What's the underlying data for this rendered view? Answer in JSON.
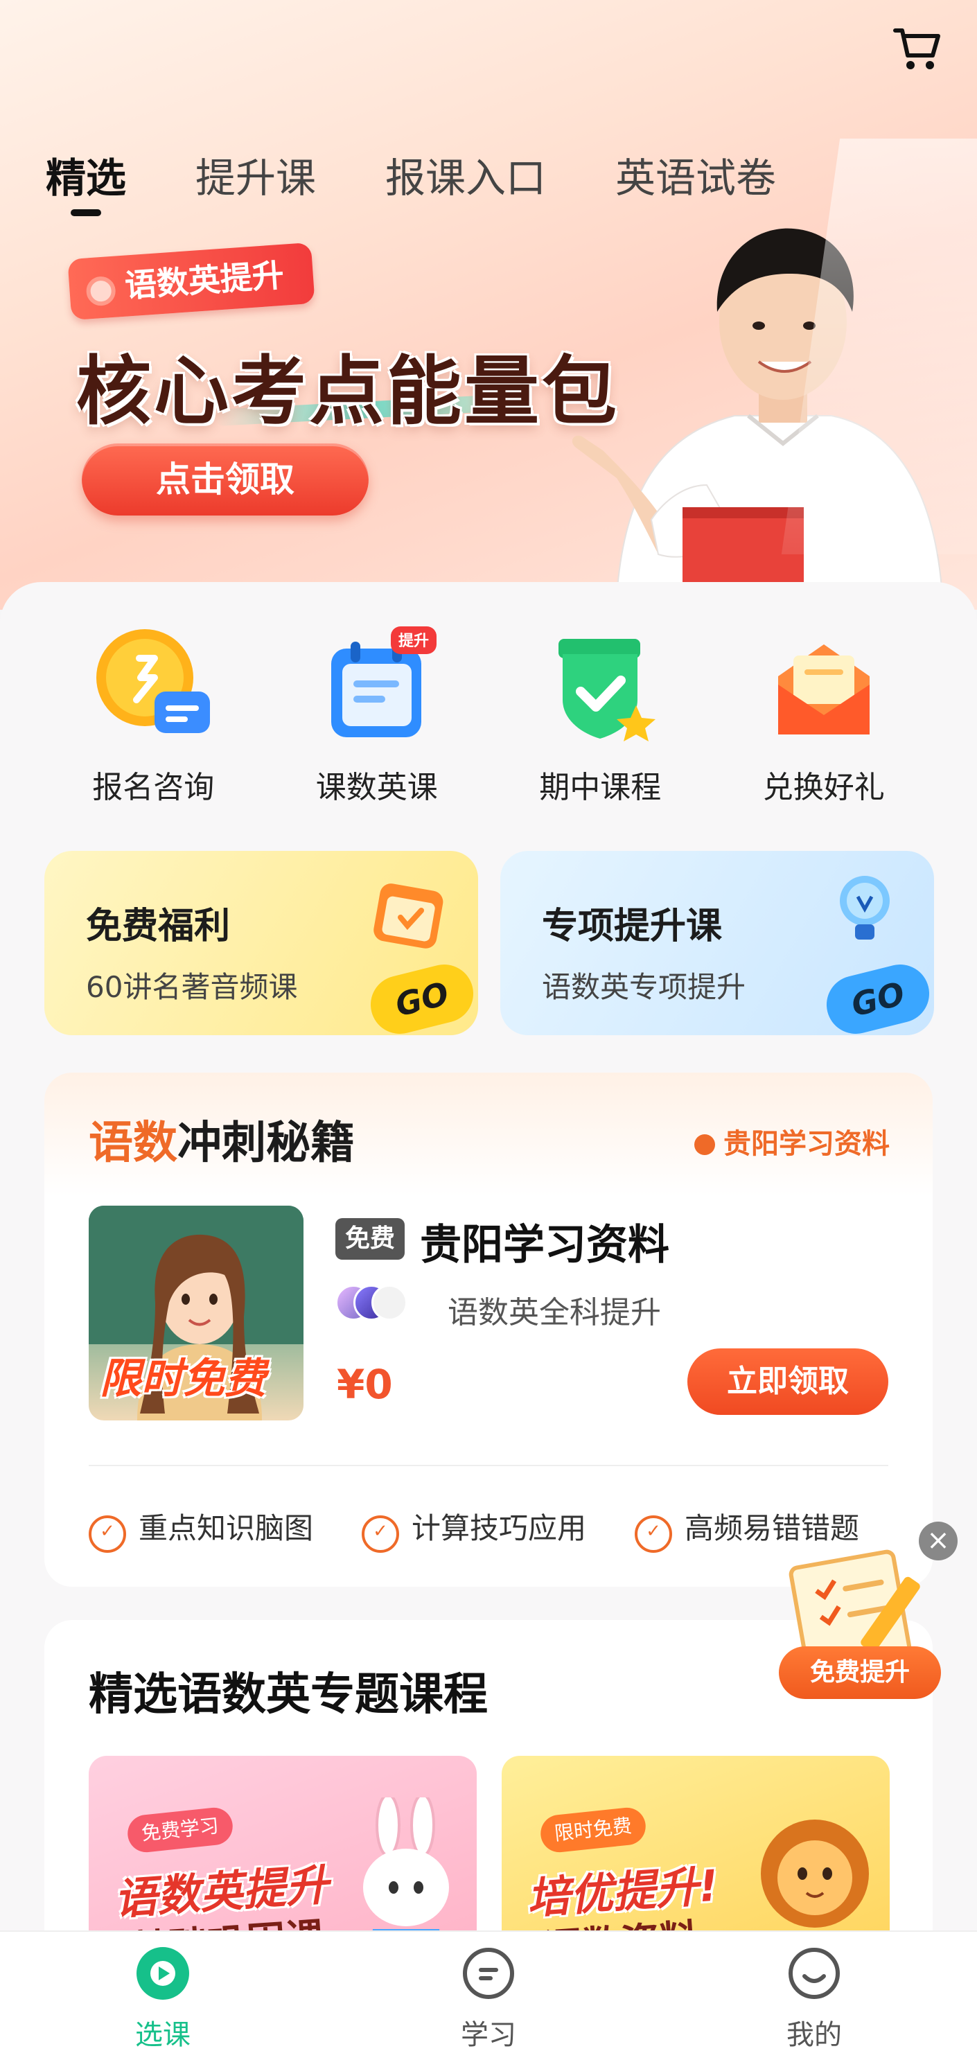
{
  "header": {
    "tabs": [
      {
        "label": "精选",
        "active": true
      },
      {
        "label": "提升课",
        "active": false
      },
      {
        "label": "报课入口",
        "active": false
      },
      {
        "label": "英语试卷",
        "active": false
      }
    ],
    "cart_icon": "cart-icon"
  },
  "banner": {
    "tag": "语数英提升",
    "headline": "核心考点能量包",
    "button": "点击领取"
  },
  "quick_entries": [
    {
      "label": "报名咨询",
      "icon": "chat-bubble-icon"
    },
    {
      "label": "课数英课",
      "icon": "calendar-icon",
      "badge": "提升"
    },
    {
      "label": "期中课程",
      "icon": "shield-check-icon"
    },
    {
      "label": "兑换好礼",
      "icon": "envelope-icon"
    }
  ],
  "promos": [
    {
      "title": "免费福利",
      "subtitle": "60讲名著音频课",
      "go": "GO"
    },
    {
      "title": "专项提升课",
      "subtitle": "语数英专项提升",
      "go": "GO"
    }
  ],
  "secrets_card": {
    "title_highlight": "语数",
    "title_rest": "冲刺秘籍",
    "side_link": "贵阳学习资料",
    "thumb_text": "限时免费",
    "badge": "免费",
    "name": "贵阳学习资料",
    "subtitle": "语数英全科提升",
    "price": "¥0",
    "cta": "立即领取",
    "features": [
      "重点知识脑图",
      "计算技巧应用",
      "高频易错错题"
    ]
  },
  "courses_card": {
    "title": "精选语数英专题课程",
    "items": [
      {
        "pill": "免费学习",
        "title": "语数英提升",
        "title2": "基础巩固课"
      },
      {
        "pill": "限时免费",
        "title": "培优提升!",
        "title2": "语数资料"
      }
    ]
  },
  "floating": {
    "close": "×",
    "label": "免费提升"
  },
  "tabbar": [
    {
      "label": "选课",
      "icon": "play-circle-icon",
      "active": true
    },
    {
      "label": "学习",
      "icon": "study-icon",
      "active": false
    },
    {
      "label": "我的",
      "icon": "profile-icon",
      "active": false
    }
  ],
  "colors": {
    "accent_orange": "#ef6a28",
    "cta_red": "#f04a22",
    "tab_active_green": "#16c08a"
  }
}
